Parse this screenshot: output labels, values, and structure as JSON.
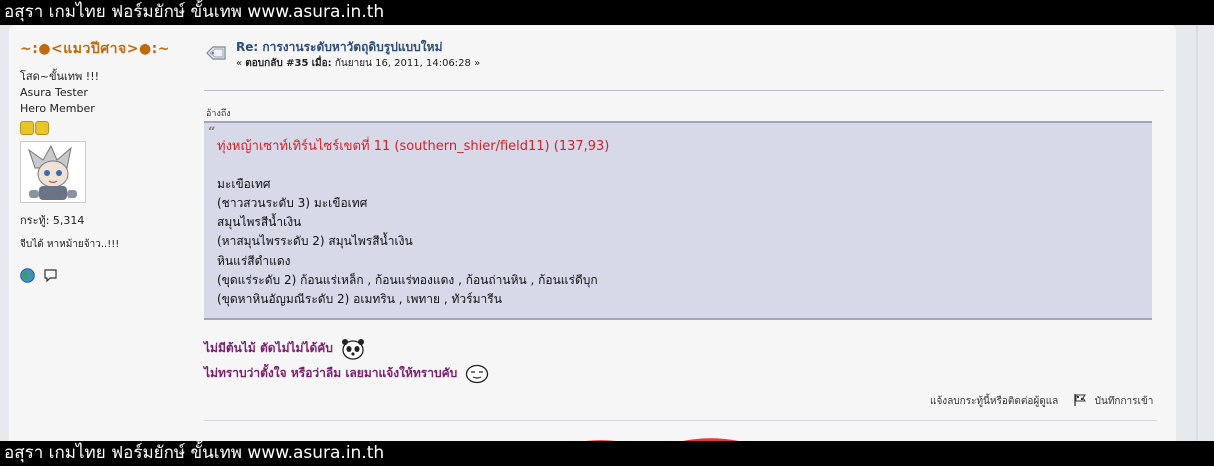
{
  "site_banner": "อสุรา เกมไทย ฟอร์มยักษ์ ขั้นเทพ www.asura.in.th",
  "poster": {
    "name": "~:●<แมวปีศาจ>●:~",
    "title": "โสด~ขั้นเทพ  !!!",
    "group": "Asura Tester",
    "rank": "Hero Member",
    "stars": 2,
    "posts_label": "กระทู้: 5,314",
    "personal_text": "จีบได้  หาหม้ายจ้าว..!!!",
    "icons": [
      "globe-icon",
      "speech-bubble-icon"
    ]
  },
  "post": {
    "subject": "Re: การงานระดับหาวัตถุดิบรูปแบบใหม่",
    "reply_label": "ตอบกลับ #35",
    "on_label": "เมื่อ:",
    "date": "กันยายน  16, 2011, 14:06:28"
  },
  "quote": {
    "header": "อ้างถึง",
    "lines": [
      "ทุ่งหญ้าเซาท์เทิร์นไซร์เขตที่   11 (southern_shier/field11) (137,93)",
      "",
      "มะเขือเทศ",
      "(ชาวสวนระดับ   3) มะเขือเทศ",
      "สมุนไพรสีน้ำเงิน",
      "(หาสมุนไพรระดับ   2) สมุนไพรสีน้ำเงิน",
      "หินแร่สีดำแดง",
      "(ขุดแร่ระดับ   2) ก้อนแร่เหล็ก   , ก้อนแร่ทองแดง   , ก้อนถ่านหิน   , ก้อนแร่ดีบุก",
      "(ขุดหาหินอัญมณีระดับ   2) อเมทริน   , เพทาย   , ทัวร์มารีน"
    ]
  },
  "signature": {
    "line1": "ไม่มีต้นไม้ ตัดไม่ไม่ได้คับ",
    "line2": "ไม่ทราบว่าตั้งใจ หรือว่าลืม เลยมาแจ้งให้ทราบคับ"
  },
  "actions": {
    "report": "แจ้งลบกระทู้นี้หรือติดต่อผู้ดูแล",
    "logged": "บันทึกการเข้า"
  },
  "colors": {
    "poster_name": "#c06a0e",
    "subject": "#2c4c7a",
    "quote_bg": "#d7d8e8",
    "quote_red": "#d0232a",
    "signature": "#7a1f6e"
  }
}
